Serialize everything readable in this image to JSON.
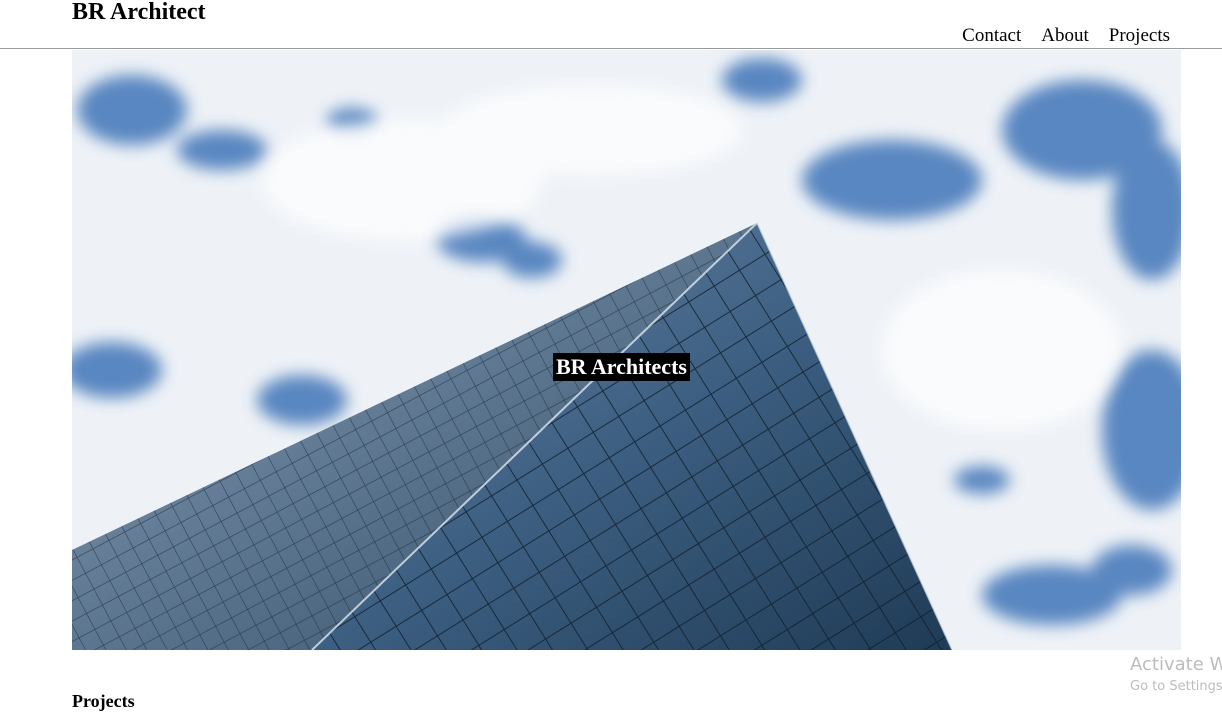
{
  "header": {
    "brand": "BR Architect",
    "nav": [
      {
        "label": "Contact"
      },
      {
        "label": "About"
      },
      {
        "label": "Projects"
      }
    ]
  },
  "hero": {
    "image": "glass skyscraper against cloudy blue sky",
    "title": "BR Architects"
  },
  "sections": {
    "projects_heading": "Projects"
  },
  "watermark": {
    "title": "Activate Windows",
    "subtitle": "Go to Settings to activate Windows."
  },
  "colors": {
    "sky_blue": "#3f74b8",
    "cloud": "#f2f5f9",
    "glass_dark": "#1f3b55",
    "title_bg": "#000000",
    "title_text": "#ffffff"
  }
}
